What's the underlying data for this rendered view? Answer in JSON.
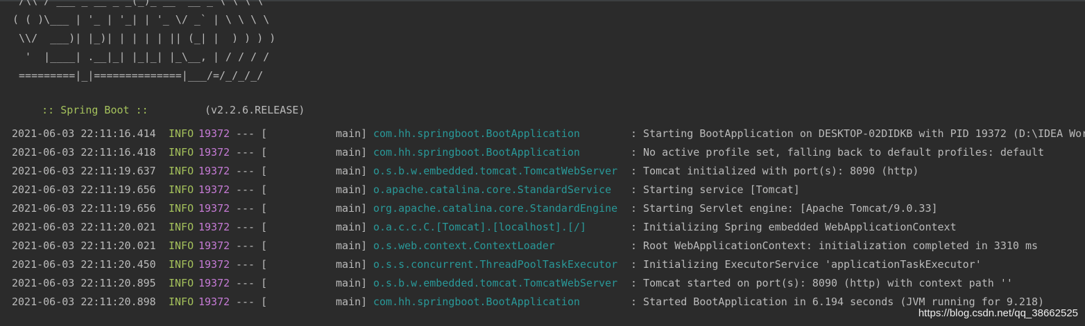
{
  "banner": [
    " /\\\\ / ___'_ __ _ _(_)_ __  __ _ \\ \\ \\ \\",
    "( ( )\\___ | '_ | '_| | '_ \\/ _` | \\ \\ \\ \\",
    " \\\\/  ___)| |_)| | | | | || (_| |  ) ) ) )",
    "  '  |____| .__|_| |_|_| |_\\__, | / / / /",
    " =========|_|==============|___/=/_/_/_/"
  ],
  "spring": {
    "label": ":: Spring Boot ::",
    "version": "(v2.2.6.RELEASE)"
  },
  "logs": [
    {
      "time": "2021-06-03 22:11:16.414",
      "level": "INFO",
      "pid": "19372",
      "sep": "--- [",
      "thread": "main]",
      "logger": "com.hh.springboot.BootApplication",
      "msg": ": Starting BootApplication on DESKTOP-02DIDKB with PID 19372 (D:\\IDEA Wor"
    },
    {
      "time": "2021-06-03 22:11:16.418",
      "level": "INFO",
      "pid": "19372",
      "sep": "--- [",
      "thread": "main]",
      "logger": "com.hh.springboot.BootApplication",
      "msg": ": No active profile set, falling back to default profiles: default"
    },
    {
      "time": "2021-06-03 22:11:19.637",
      "level": "INFO",
      "pid": "19372",
      "sep": "--- [",
      "thread": "main]",
      "logger": "o.s.b.w.embedded.tomcat.TomcatWebServer",
      "msg": ": Tomcat initialized with port(s): 8090 (http)"
    },
    {
      "time": "2021-06-03 22:11:19.656",
      "level": "INFO",
      "pid": "19372",
      "sep": "--- [",
      "thread": "main]",
      "logger": "o.apache.catalina.core.StandardService",
      "msg": ": Starting service [Tomcat]"
    },
    {
      "time": "2021-06-03 22:11:19.656",
      "level": "INFO",
      "pid": "19372",
      "sep": "--- [",
      "thread": "main]",
      "logger": "org.apache.catalina.core.StandardEngine",
      "msg": ": Starting Servlet engine: [Apache Tomcat/9.0.33]"
    },
    {
      "time": "2021-06-03 22:11:20.021",
      "level": "INFO",
      "pid": "19372",
      "sep": "--- [",
      "thread": "main]",
      "logger": "o.a.c.c.C.[Tomcat].[localhost].[/]",
      "msg": ": Initializing Spring embedded WebApplicationContext"
    },
    {
      "time": "2021-06-03 22:11:20.021",
      "level": "INFO",
      "pid": "19372",
      "sep": "--- [",
      "thread": "main]",
      "logger": "o.s.web.context.ContextLoader",
      "msg": ": Root WebApplicationContext: initialization completed in 3310 ms"
    },
    {
      "time": "2021-06-03 22:11:20.450",
      "level": "INFO",
      "pid": "19372",
      "sep": "--- [",
      "thread": "main]",
      "logger": "o.s.s.concurrent.ThreadPoolTaskExecutor",
      "msg": ": Initializing ExecutorService 'applicationTaskExecutor'"
    },
    {
      "time": "2021-06-03 22:11:20.895",
      "level": "INFO",
      "pid": "19372",
      "sep": "--- [",
      "thread": "main]",
      "logger": "o.s.b.w.embedded.tomcat.TomcatWebServer",
      "msg": ": Tomcat started on port(s): 8090 (http) with context path ''"
    },
    {
      "time": "2021-06-03 22:11:20.898",
      "level": "INFO",
      "pid": "19372",
      "sep": "--- [",
      "thread": "main]",
      "logger": "com.hh.springboot.BootApplication",
      "msg": ": Started BootApplication in 6.194 seconds (JVM running for 9.218)"
    }
  ],
  "watermark": "https://blog.csdn.net/qq_38662525",
  "colors": {
    "background": "#2b2b2b",
    "text": "#bbbbbb",
    "level": "#a5c25c",
    "pid": "#c67bd6",
    "logger": "#299999"
  }
}
